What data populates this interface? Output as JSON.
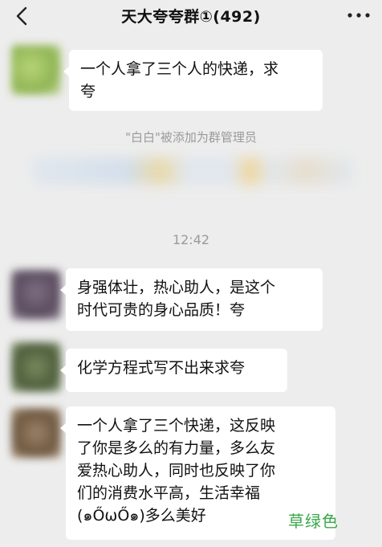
{
  "header": {
    "title": "天大夸夸群①(492)",
    "back_icon": "chevron-left-icon",
    "more_icon": "more-dots-icon"
  },
  "messages": [
    {
      "type": "text",
      "text": "一个人拿了三个人的快递，求\n夸",
      "avatar_color": "#a9c66b"
    },
    {
      "type": "system",
      "text": "\"白白\"被添加为群管理员"
    },
    {
      "type": "time",
      "text": "12:42"
    },
    {
      "type": "text",
      "text": "身强体壮，热心助人，是这个\n时代可贵的身心品质！夸",
      "avatar_color": "#6a5a6e"
    },
    {
      "type": "text",
      "text": "化学方程式写不出来求夸",
      "avatar_color": "#5e6e4a"
    },
    {
      "type": "text",
      "text": "一个人拿了三个快递，这反映\n了你是多么的有力量，多么友\n爱热心助人，同时也反映了你\n们的消费水平高，生活幸福(๑ŐωŐ๑)多么美好",
      "avatar_color": "#8a7258"
    }
  ],
  "watermark": "草绿色",
  "colors": {
    "background": "#ededed",
    "bubble": "#ffffff",
    "system_text": "#9a9a9a",
    "watermark": "#3aa84a"
  }
}
